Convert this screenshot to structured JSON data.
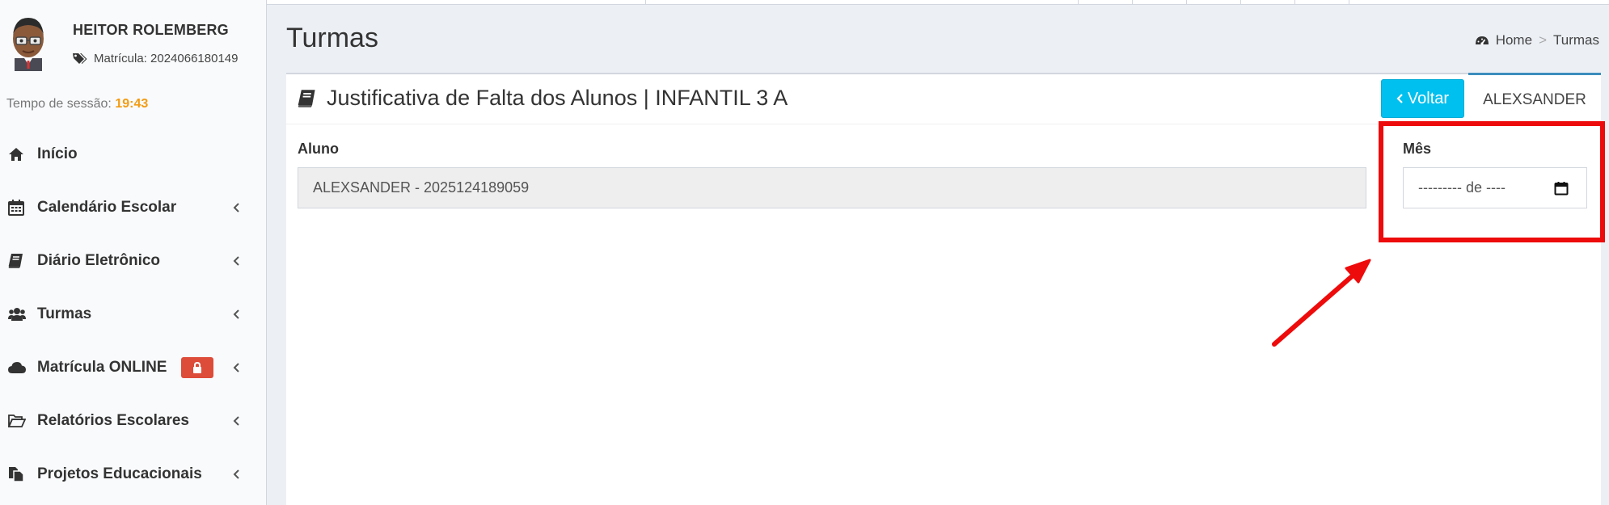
{
  "user": {
    "name": "HEITOR ROLEMBERG",
    "matricula": "Matrícula: 2024066180149"
  },
  "session": {
    "label": "Tempo de sessão:",
    "time": "19:43"
  },
  "menu": {
    "items": [
      {
        "label": "Início",
        "icon": "home-icon"
      },
      {
        "label": "Calendário Escolar",
        "icon": "calendar-icon"
      },
      {
        "label": "Diário Eletrônico",
        "icon": "book-icon"
      },
      {
        "label": "Turmas",
        "icon": "users-icon"
      },
      {
        "label": "Matrícula ONLINE",
        "icon": "cloud-icon"
      },
      {
        "label": "Relatórios Escolares",
        "icon": "folder-open-icon"
      },
      {
        "label": "Projetos Educacionais",
        "icon": "copy-icon"
      }
    ]
  },
  "header": {
    "title": "Turmas",
    "breadcrumb": [
      "Home",
      "Turmas"
    ]
  },
  "box": {
    "title": "Justificativa de Falta dos Alunos | INFANTIL 3 A",
    "voltar_label": "Voltar",
    "tab_label": "ALEXSANDER",
    "aluno_label": "Aluno",
    "aluno_value": "ALEXSANDER - 2025124189059",
    "mes_label": "Mês",
    "mes_placeholder": "--------- de ----"
  },
  "colors": {
    "accent": "#00c0ef",
    "session_time": "#f39c12",
    "lock_badge": "#dd4b39",
    "annotation": "#ee0b0b"
  }
}
